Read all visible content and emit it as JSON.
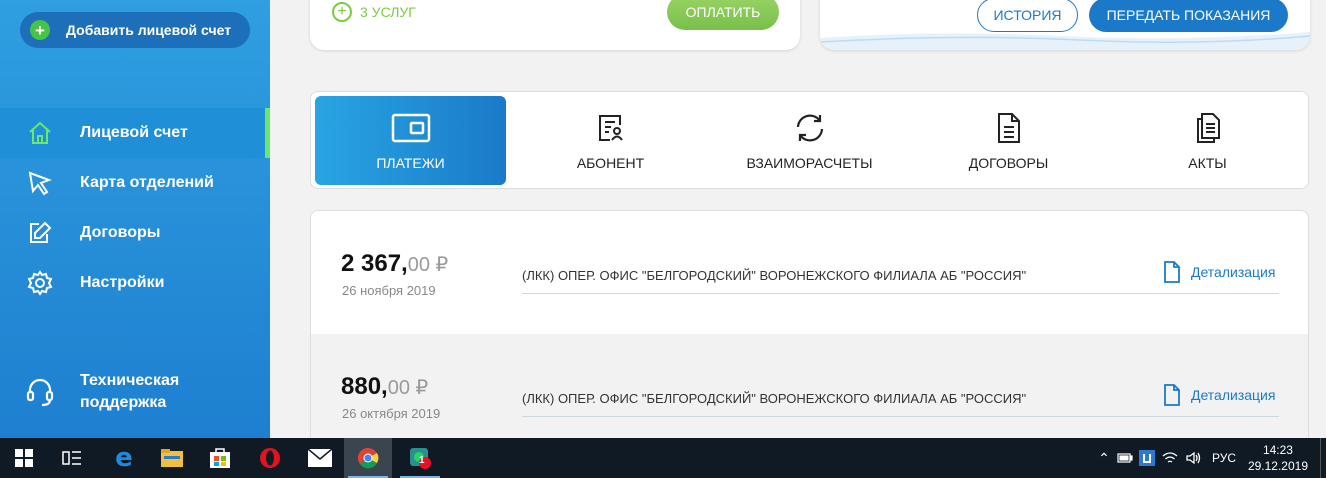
{
  "sidebar": {
    "add_account_label": "Добавить лицевой счет",
    "items": [
      {
        "label": "Лицевой счет",
        "icon": "home-icon",
        "active": true
      },
      {
        "label": "Карта отделений",
        "icon": "map-pin-icon",
        "active": false
      },
      {
        "label": "Договоры",
        "icon": "edit-icon",
        "active": false
      },
      {
        "label": "Настройки",
        "icon": "gear-icon",
        "active": false
      }
    ],
    "support_label": "Техническая поддержка"
  },
  "top_cards": {
    "services_label": "3 УСЛУГ",
    "pay_label": "ОПЛАТИТЬ",
    "history_label": "ИСТОРИЯ",
    "submit_readings_label": "ПЕРЕДАТЬ ПОКАЗАНИЯ"
  },
  "tabs": [
    {
      "label": "ПЛАТЕЖИ",
      "icon": "wallet-icon",
      "active": true
    },
    {
      "label": "АБОНЕНТ",
      "icon": "subscriber-icon",
      "active": false
    },
    {
      "label": "ВЗАИМОРАСЧЕТЫ",
      "icon": "refresh-icon",
      "active": false
    },
    {
      "label": "ДОГОВОРЫ",
      "icon": "document-icon",
      "active": false
    },
    {
      "label": "АКТЫ",
      "icon": "documents-icon",
      "active": false
    }
  ],
  "payments": [
    {
      "amount_main": "2 367,",
      "amount_cents": "00 ₽",
      "date": "26 ноября 2019",
      "payee": "(ЛКК) ОПЕР. ОФИС \"БЕЛГОРОДСКИЙ\" ВОРОНЕЖСКОГО ФИЛИАЛА АБ \"РОССИЯ\"",
      "detail_label": "Детализация"
    },
    {
      "amount_main": "880,",
      "amount_cents": "00 ₽",
      "date": "26 октября 2019",
      "payee": "(ЛКК) ОПЕР. ОФИС \"БЕЛГОРОДСКИЙ\" ВОРОНЕЖСКОГО ФИЛИАЛА АБ \"РОССИЯ\"",
      "detail_label": "Детализация"
    }
  ],
  "taskbar": {
    "language": "РУС",
    "time": "14:23",
    "date": "29.12.2019",
    "notification_badge": "1",
    "apps": [
      "windows-start-icon",
      "task-view-icon",
      "edge-icon",
      "file-explorer-icon",
      "store-icon",
      "opera-icon",
      "mail-icon",
      "chrome-icon",
      "whatsapp-icon"
    ]
  },
  "colors": {
    "sidebar": "#2f9fe0",
    "accent_blue": "#1a7ac9",
    "accent_green": "#7ccb44",
    "active_marker": "#6be76b"
  }
}
